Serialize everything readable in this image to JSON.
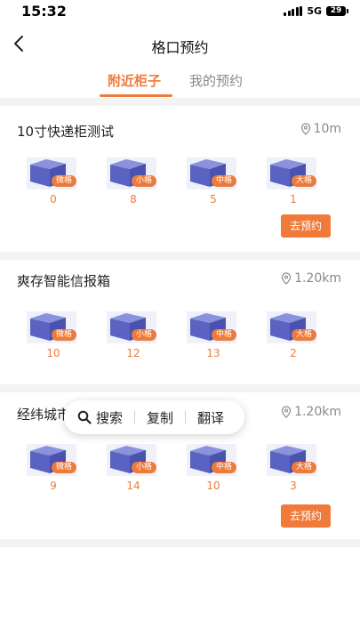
{
  "status": {
    "time": "15:32",
    "network": "5G",
    "battery": "29"
  },
  "nav": {
    "title": "格口预约",
    "back_icon": "chevron-left-icon"
  },
  "tabs": [
    {
      "label": "附近柜子",
      "active": true
    },
    {
      "label": "我的预约",
      "active": false
    }
  ],
  "cabinets": [
    {
      "name": "10寸快递柜测试",
      "distance": "10m",
      "slots": [
        {
          "size": "微格",
          "count": "0"
        },
        {
          "size": "小格",
          "count": "8"
        },
        {
          "size": "中格",
          "count": "5"
        },
        {
          "size": "大格",
          "count": "1"
        }
      ],
      "button": "去预约"
    },
    {
      "name": "爽存智能信报箱",
      "distance": "1.20km",
      "slots": [
        {
          "size": "微格",
          "count": "10"
        },
        {
          "size": "小格",
          "count": "12"
        },
        {
          "size": "中格",
          "count": "13"
        },
        {
          "size": "大格",
          "count": "2"
        }
      ],
      "button": ""
    },
    {
      "name": "经纬城市",
      "distance": "1.20km",
      "slots": [
        {
          "size": "微格",
          "count": "9"
        },
        {
          "size": "小格",
          "count": "14"
        },
        {
          "size": "中格",
          "count": "10"
        },
        {
          "size": "大格",
          "count": "3"
        }
      ],
      "button": "去预约"
    }
  ],
  "context_menu": {
    "search": "搜索",
    "copy": "复制",
    "translate": "翻译"
  },
  "colors": {
    "accent": "#ef7a3a",
    "box": "#5b63c2",
    "background_gap": "#f3f3f3"
  }
}
